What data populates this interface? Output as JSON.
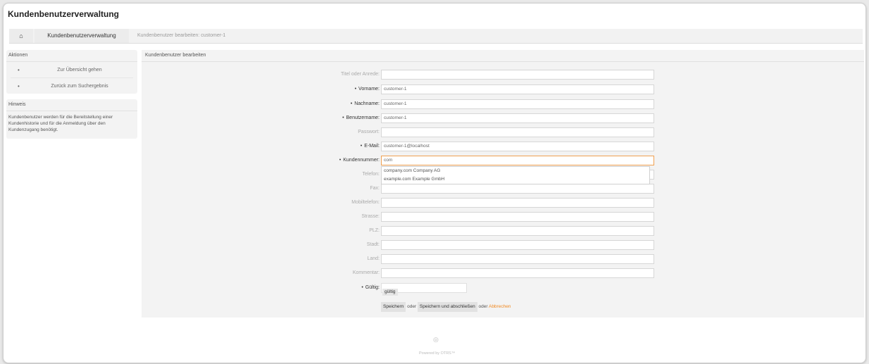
{
  "app": {
    "title": "Kundenbenutzerverwaltung"
  },
  "nav": {
    "home_icon": "⌂",
    "title": "Kundenbenutzerverwaltung",
    "breadcrumb": "Kundenbenutzer bearbeiten: customer-1"
  },
  "sidebar": {
    "actions_title": "Aktionen",
    "actions": [
      {
        "bullet": "•",
        "label": "Zur Übersicht gehen"
      },
      {
        "bullet": "•",
        "label": "Zurück zum Suchergebnis"
      }
    ],
    "hint_title": "Hinweis",
    "hint_text": "Kundenbenutzer werden für die Bereitstellung einer Kundenhistorie und für die Anmeldung über den Kundenzugang benötigt."
  },
  "form": {
    "title": "Kundenbenutzer bearbeiten",
    "fields": [
      {
        "label": "Titel oder Anrede:",
        "value": "",
        "required": false
      },
      {
        "label": "Vorname:",
        "value": "customer-1",
        "required": true
      },
      {
        "label": "Nachname:",
        "value": "customer-1",
        "required": true
      },
      {
        "label": "Benutzername:",
        "value": "customer-1",
        "required": true
      },
      {
        "label": "Passwort:",
        "value": "",
        "required": false
      },
      {
        "label": "E-Mail:",
        "value": "customer-1@localhost",
        "required": true
      },
      {
        "label": "Kundennummer:",
        "value": "com",
        "required": true
      },
      {
        "label": "Telefon:",
        "value": "",
        "required": false
      },
      {
        "label": "Fax:",
        "value": "",
        "required": false
      },
      {
        "label": "Mobiltelefon:",
        "value": "",
        "required": false
      },
      {
        "label": "Strasse:",
        "value": "",
        "required": false
      },
      {
        "label": "PLZ:",
        "value": "",
        "required": false
      },
      {
        "label": "Stadt:",
        "value": "",
        "required": false
      },
      {
        "label": "Land:",
        "value": "",
        "required": false
      },
      {
        "label": "Kommentar:",
        "value": "",
        "required": false
      }
    ],
    "required_marker": "•",
    "autocomplete": [
      "company.com Company AG",
      "example.com Example GmbH"
    ],
    "valid": {
      "label": "Gültig:",
      "value": "gültig"
    },
    "save": "Speichern",
    "or": "oder",
    "save_finish": "Speichern und abschließen",
    "cancel": "Abbrechen"
  },
  "footer": {
    "icon": "◎",
    "text": "Powered by OTRS™"
  }
}
